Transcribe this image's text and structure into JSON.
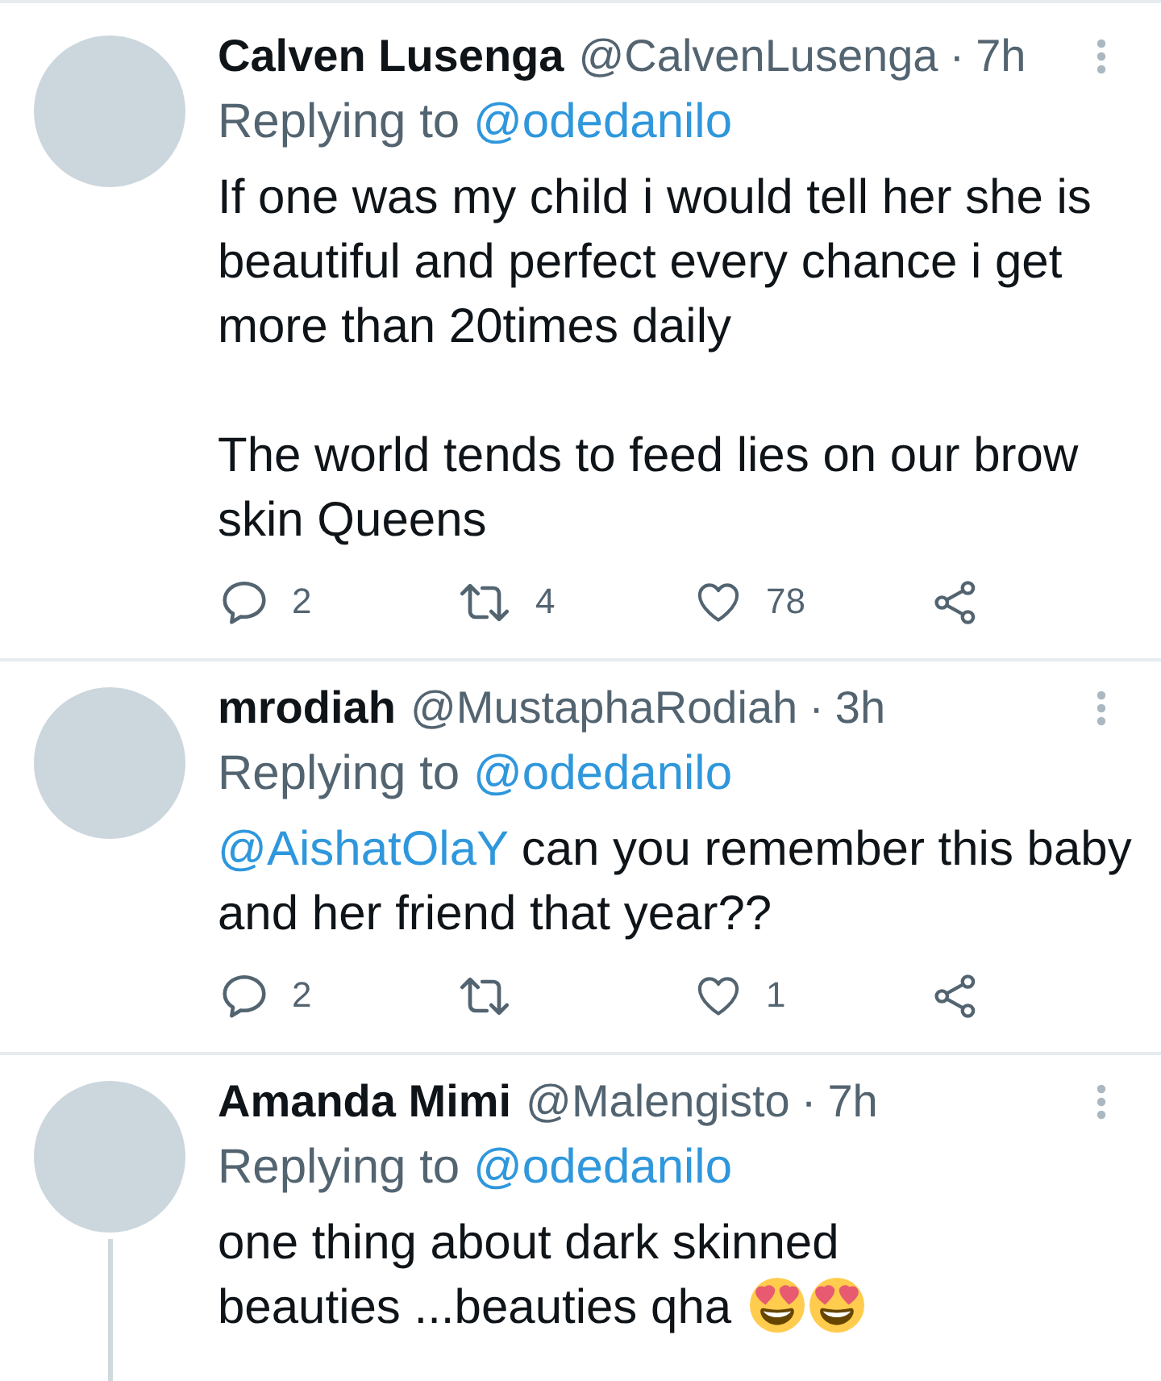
{
  "tweets": [
    {
      "name": "Calven Lusenga",
      "handle": "@CalvenLusenga",
      "separator": "·",
      "time": "7h",
      "replying_label": "Replying to",
      "reply_to": "@odedanilo",
      "thread_line": false,
      "paragraphs": [
        {
          "text": "If one was my child i would tell her she is beautiful and perfect every chance i get more than 20times daily"
        },
        {
          "text": "The world tends to feed lies on our brow skin Queens"
        }
      ],
      "actions": [
        {
          "kind": "reply",
          "count": "2"
        },
        {
          "kind": "retweet",
          "count": "4"
        },
        {
          "kind": "like",
          "count": "78"
        },
        {
          "kind": "share"
        }
      ]
    },
    {
      "name": "mrodiah",
      "handle": "@MustaphaRodiah",
      "separator": "·",
      "time": "3h",
      "replying_label": "Replying to",
      "reply_to": "@odedanilo",
      "thread_line": false,
      "paragraphs": [
        {
          "mention": "@AishatOlaY",
          "text": "can you remember this baby and her friend that year??"
        }
      ],
      "actions": [
        {
          "kind": "reply",
          "count": "2"
        },
        {
          "kind": "retweet"
        },
        {
          "kind": "like",
          "count": "1"
        },
        {
          "kind": "share"
        }
      ]
    },
    {
      "name": "Amanda Mimi",
      "handle": "@Malengisto",
      "separator": "·",
      "time": "7h",
      "replying_label": "Replying to",
      "reply_to": "@odedanilo",
      "thread_line": true,
      "paragraphs": [
        {
          "text": "one thing about dark skinned\nbeauties ...beauties qha",
          "emojis": [
            {
              "kind": "heart-eyes"
            },
            {
              "kind": "heart-eyes"
            }
          ]
        }
      ]
    }
  ]
}
